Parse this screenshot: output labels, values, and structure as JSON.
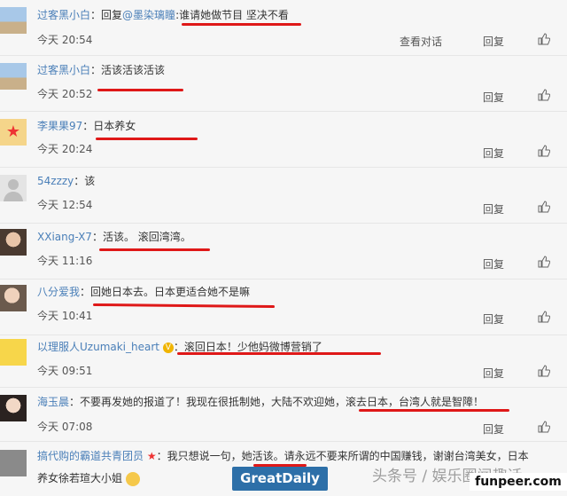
{
  "actions": {
    "view_thread": "查看对话",
    "reply": "回复"
  },
  "comments": [
    {
      "user": "过客黑小白",
      "colon": "：",
      "prefix": "回复",
      "mention": "@墨染璃瞳",
      "text": ":谁请她做节目 坚决不看",
      "time": "今天 20:54"
    },
    {
      "user": "过客黑小白",
      "colon": "：",
      "text": "活该活该活该",
      "time": "今天 20:52"
    },
    {
      "user": "李果果97",
      "colon": "：",
      "text": "日本养女",
      "time": "今天 20:24"
    },
    {
      "user": "54zzzy",
      "colon": "：",
      "text": "该",
      "time": "今天 12:54"
    },
    {
      "user": "XXiang-X7",
      "colon": "：",
      "text": "活该。 滚回湾湾。",
      "time": "今天 11:16"
    },
    {
      "user": "八分爱我",
      "colon": "：",
      "text": "回她日本去。日本更适合她不是嘛",
      "time": "今天 10:41"
    },
    {
      "user": "以理服人Uzumaki_heart",
      "colon": "：",
      "text": "滚回日本！少他妈微博营销了",
      "time": "今天 09:51"
    },
    {
      "user": "海玉晨",
      "colon": "：",
      "text": "不要再发她的报道了！我现在很抵制她，大陆不欢迎她，滚去日本，台湾人就是智障！",
      "time": "今天 07:08"
    },
    {
      "user": "搞代购的霸道共青团员",
      "colon": "：",
      "text": "我只想说一句，她活该。请永远不要来所谓的中国赚钱，谢谢台湾美女，日本",
      "text2": "养女徐若瑄大小姐"
    }
  ],
  "watermarks": {
    "greatdaily": "GreatDaily",
    "toutiao": "头条号 / 娱乐圈闻趣话",
    "funpeer": "funpeer.com"
  },
  "colors": {
    "username": "#4a7fb8",
    "underline": "#d00000",
    "badge": "#f0b400"
  },
  "icons": [
    "thumbs-up-icon",
    "verified-badge-icon",
    "star-badge-icon",
    "smiley-emoji-icon"
  ]
}
